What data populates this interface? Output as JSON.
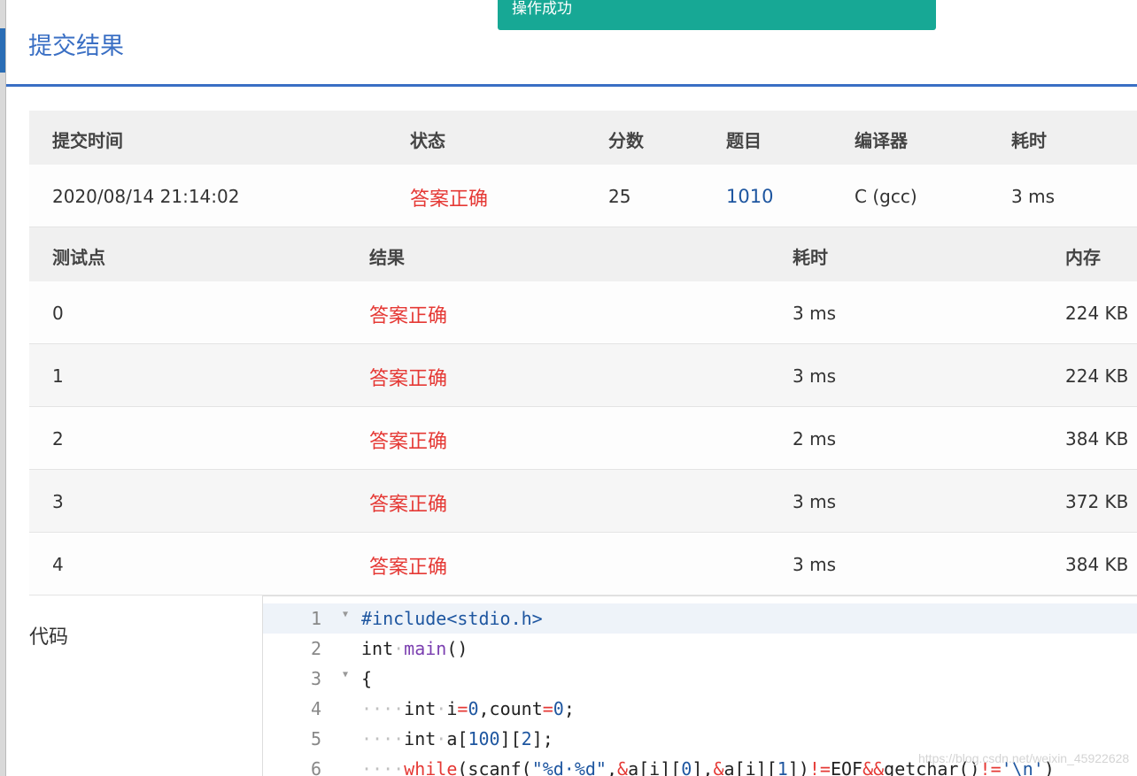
{
  "modal": {
    "title": "提交结果",
    "toast": "操作成功"
  },
  "summary": {
    "headers": [
      "提交时间",
      "状态",
      "分数",
      "题目",
      "编译器",
      "耗时"
    ],
    "row": {
      "time": "2020/08/14 21:14:02",
      "status": "答案正确",
      "score": "25",
      "problem": "1010",
      "compiler": "C (gcc)",
      "elapsed": "3 ms"
    }
  },
  "tests": {
    "headers": [
      "测试点",
      "结果",
      "耗时",
      "内存"
    ],
    "rows": [
      {
        "id": "0",
        "result": "答案正确",
        "time": "3 ms",
        "memory": "224 KB"
      },
      {
        "id": "1",
        "result": "答案正确",
        "time": "3 ms",
        "memory": "224 KB"
      },
      {
        "id": "2",
        "result": "答案正确",
        "time": "2 ms",
        "memory": "384 KB"
      },
      {
        "id": "3",
        "result": "答案正确",
        "time": "3 ms",
        "memory": "372 KB"
      },
      {
        "id": "4",
        "result": "答案正确",
        "time": "3 ms",
        "memory": "384 KB"
      }
    ]
  },
  "code": {
    "label": "代码",
    "line_numbers": [
      "1",
      "2",
      "3",
      "4",
      "5",
      "6"
    ]
  },
  "colors": {
    "accent": "#3a6fc4",
    "success": "#17a895",
    "ok_text": "#e53935",
    "link": "#1e56a0"
  },
  "watermark": "https://blog.csdn.net/weixin_45922628"
}
